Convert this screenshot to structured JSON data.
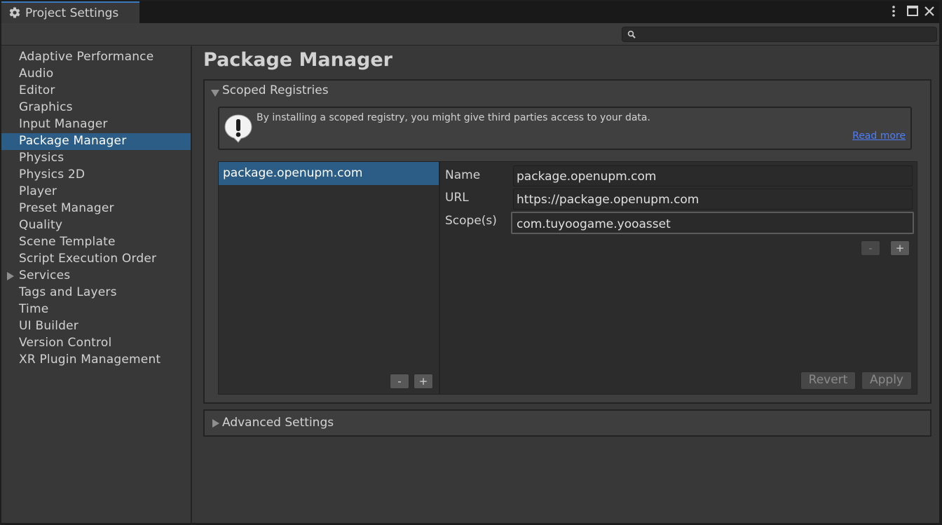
{
  "window": {
    "tab_title": "Project Settings",
    "icons": {
      "tab": "gear-icon",
      "menu": "more-vert-icon",
      "maximize": "maximize-icon",
      "close": "close-icon",
      "search": "search-icon"
    }
  },
  "search": {
    "value": "",
    "placeholder": ""
  },
  "sidebar": {
    "items": [
      {
        "label": "Adaptive Performance"
      },
      {
        "label": "Audio"
      },
      {
        "label": "Editor"
      },
      {
        "label": "Graphics"
      },
      {
        "label": "Input Manager"
      },
      {
        "label": "Package Manager",
        "selected": true
      },
      {
        "label": "Physics"
      },
      {
        "label": "Physics 2D"
      },
      {
        "label": "Player"
      },
      {
        "label": "Preset Manager"
      },
      {
        "label": "Quality"
      },
      {
        "label": "Scene Template"
      },
      {
        "label": "Script Execution Order"
      },
      {
        "label": "Services",
        "expandable": true
      },
      {
        "label": "Tags and Layers"
      },
      {
        "label": "Time"
      },
      {
        "label": "UI Builder"
      },
      {
        "label": "Version Control"
      },
      {
        "label": "XR Plugin Management"
      }
    ]
  },
  "main": {
    "title": "Package Manager",
    "scoped_registries": {
      "label": "Scoped Registries",
      "expanded": true,
      "warning_text": "By installing a scoped registry, you might give third parties access to your data.",
      "read_more": "Read more",
      "registries": [
        {
          "name": "package.openupm.com"
        }
      ],
      "list_remove": "-",
      "list_add": "+",
      "fields": {
        "name_label": "Name",
        "name_value": "package.openupm.com",
        "url_label": "URL",
        "url_value": "https://package.openupm.com",
        "scopes_label": "Scope(s)",
        "scopes_value": "com.tuyoogame.yooasset"
      },
      "scope_remove": "-",
      "scope_add": "+",
      "revert": "Revert",
      "apply": "Apply"
    },
    "advanced_settings": {
      "label": "Advanced Settings",
      "expanded": false
    }
  },
  "colors": {
    "background": "#383838",
    "selection": "#2c5d87",
    "link": "#4c7efc",
    "tab_accent": "#3a79bb"
  }
}
